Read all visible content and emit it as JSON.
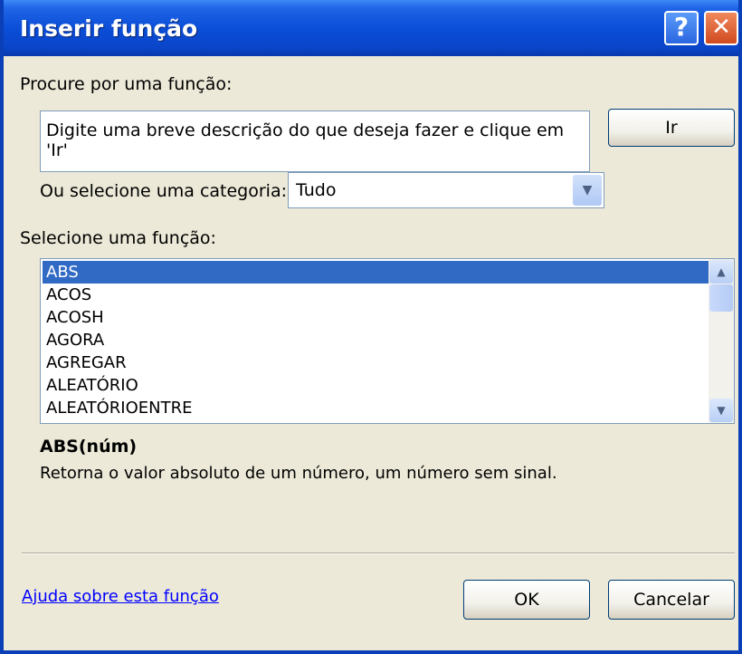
{
  "window": {
    "title": "Inserir função",
    "help_glyph": "?",
    "close_glyph": "✕"
  },
  "search": {
    "label": "Procure por uma função:",
    "text": "Digite uma breve descrição do que deseja fazer e clique em 'Ir'",
    "go_label": "Ir"
  },
  "category": {
    "label": "Ou selecione uma categoria:",
    "selected": "Tudo"
  },
  "functions": {
    "label": "Selecione uma função:",
    "items": [
      "ABS",
      "ACOS",
      "ACOSH",
      "AGORA",
      "AGREGAR",
      "ALEATÓRIO",
      "ALEATÓRIOENTRE"
    ],
    "selected": "ABS"
  },
  "details": {
    "signature": "ABS(núm)",
    "description": "Retorna o valor absoluto de um número, um número sem sinal."
  },
  "footer": {
    "help_link": "Ajuda sobre esta função",
    "ok_label": "OK",
    "cancel_label": "Cancelar"
  },
  "icons": {
    "dropdown": "chevron-down-icon",
    "scroll_up": "chevron-up-icon",
    "scroll_down": "chevron-down-icon"
  },
  "colors": {
    "titlebar": "#0b4ed8",
    "selection": "#316ac5",
    "dialog_bg": "#ece9d8",
    "link": "#0000ff"
  }
}
